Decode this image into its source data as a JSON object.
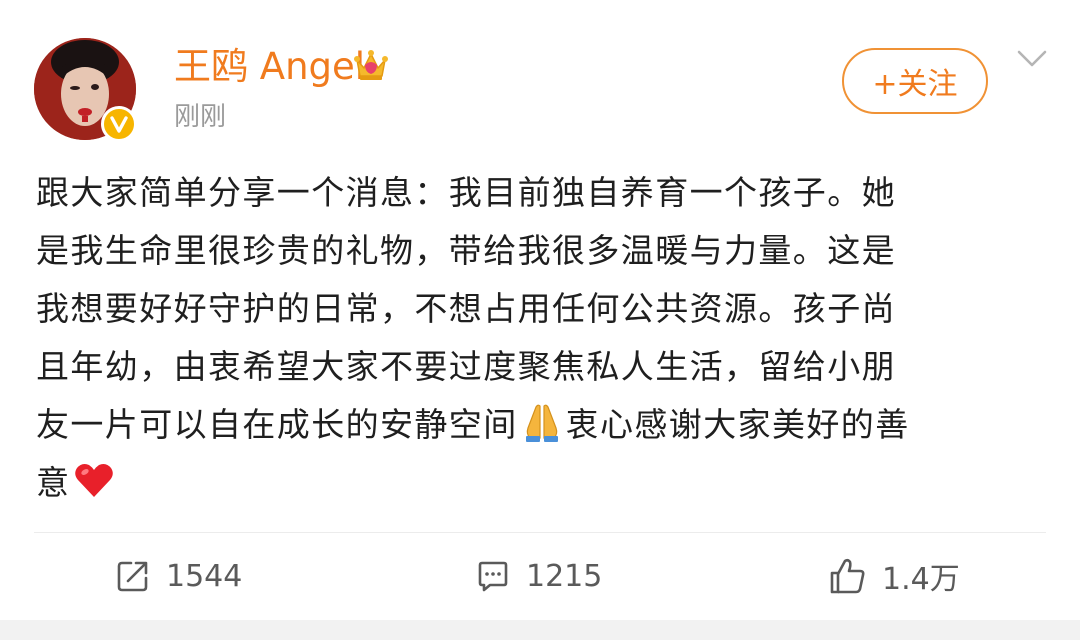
{
  "post": {
    "author": {
      "name": "王鸥 Angel",
      "time": "刚刚",
      "avatar_icon": "user-avatar",
      "badge_icon": "verified-v-badge-icon",
      "crown_icon": "crown-icon"
    },
    "follow_label": "+关注",
    "more_icon": "chevron-down-icon",
    "content_lines": [
      "跟大家简单分享一个消息：我目前独自养育一个孩子。她",
      "是我生命里很珍贵的礼物，带给我很多温暖与力量。这是",
      "我想要好好守护的日常，不想占用任何公共资源。孩子尚",
      "且年幼，由衷希望大家不要过度聚焦私人生活，留给小朋",
      "友一片可以自在成长的安静空间",
      "衷心感谢大家美好的善",
      "意"
    ],
    "emojis": {
      "pray": "pray-emoji",
      "heart": "heart-emoji"
    }
  },
  "actions": {
    "repost_count": "1544",
    "comment_count": "1215",
    "like_count": "1.4万"
  },
  "colors": {
    "accent": "#f07b1e",
    "text": "#1f1f1f",
    "muted": "#9a9a9a",
    "verified": "#f7b500"
  }
}
